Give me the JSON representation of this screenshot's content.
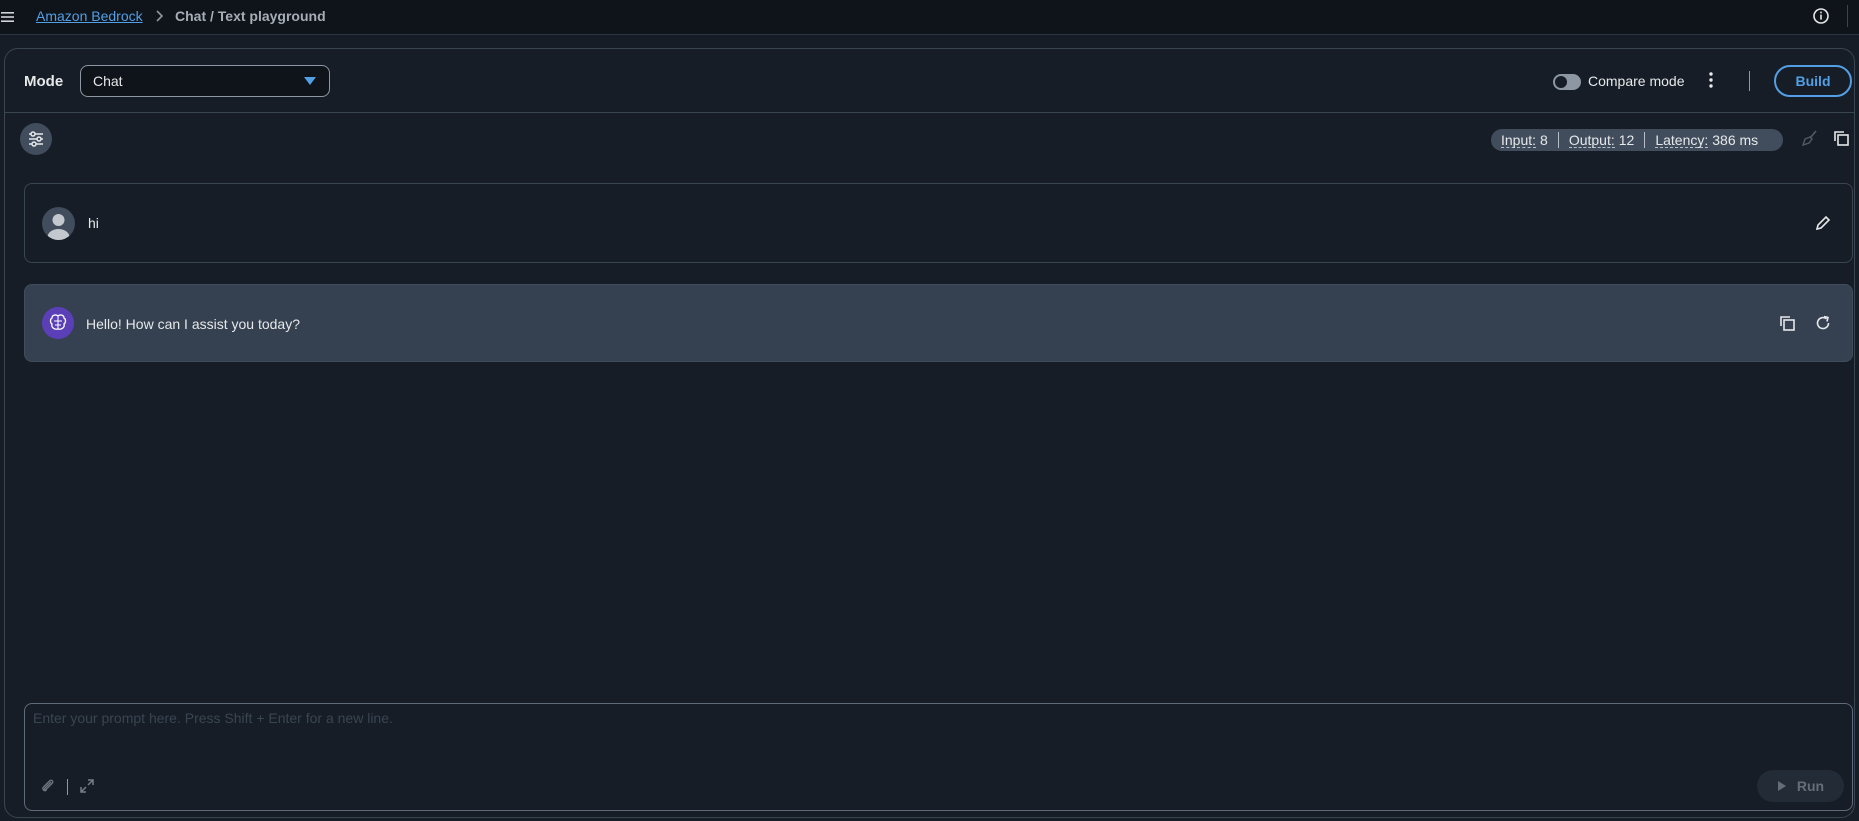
{
  "breadcrumb": {
    "root": "Amazon Bedrock",
    "current": "Chat / Text playground"
  },
  "header": {
    "mode_label": "Mode",
    "mode_value": "Chat",
    "compare_label": "Compare mode",
    "compare_enabled": false,
    "build_label": "Build"
  },
  "metrics": {
    "input_key": "Input:",
    "input_val": "8",
    "output_key": "Output:",
    "output_val": "12",
    "latency_key": "Latency:",
    "latency_val": "386 ms"
  },
  "messages": [
    {
      "role": "user",
      "text": "hi"
    },
    {
      "role": "assistant",
      "text": "Hello! How can I assist you today?"
    }
  ],
  "prompt": {
    "placeholder": "Enter your prompt here. Press Shift + Enter for a new line.",
    "run_label": "Run"
  },
  "icons": {
    "menu": "menu-icon",
    "info": "info-icon",
    "settings": "sliders-icon",
    "clear": "broom-icon",
    "copy": "copy-icon",
    "edit": "pencil-icon",
    "regenerate": "refresh-icon",
    "attach": "paperclip-icon",
    "expand": "expand-icon",
    "play": "play-icon"
  },
  "colors": {
    "background": "#161d26",
    "topbar": "#0f141a",
    "accent": "#539fe5",
    "assistant_bubble": "#354150",
    "ai_avatar": "#5b3fb6"
  }
}
